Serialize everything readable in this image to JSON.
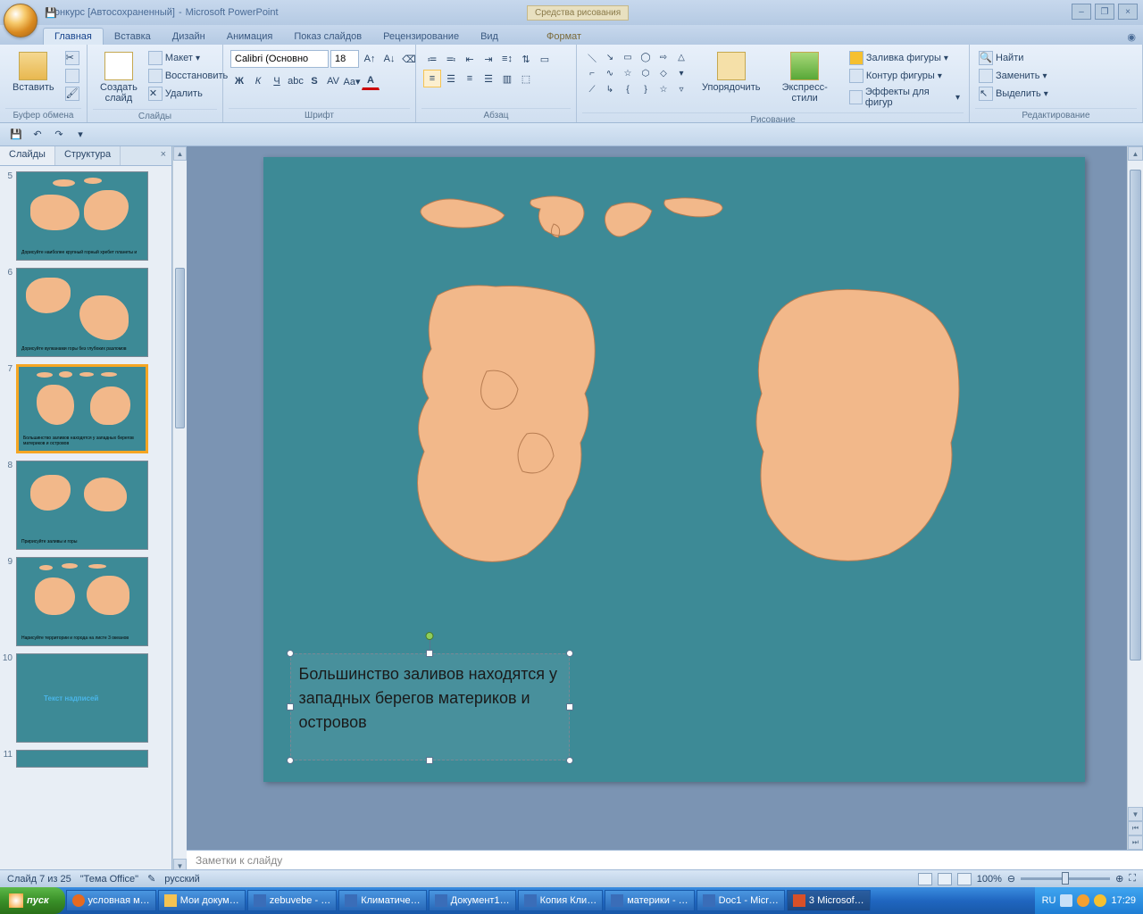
{
  "title": {
    "doc": "конкурс [Автосохраненный]",
    "app": "Microsoft PowerPoint",
    "context_tab": "Средства рисования"
  },
  "win_controls": {
    "min": "–",
    "restore": "❐",
    "close": "×"
  },
  "tabs": {
    "home": "Главная",
    "insert": "Вставка",
    "design": "Дизайн",
    "anim": "Анимация",
    "show": "Показ слайдов",
    "review": "Рецензирование",
    "view": "Вид",
    "format": "Формат"
  },
  "groups": {
    "clipboard": "Буфер обмена",
    "slides": "Слайды",
    "font": "Шрифт",
    "para": "Абзац",
    "drawing": "Рисование",
    "editing": "Редактирование"
  },
  "clipboard": {
    "paste": "Вставить"
  },
  "slides": {
    "new": "Создать\nслайд",
    "layout": "Макет",
    "reset": "Восстановить",
    "delete": "Удалить"
  },
  "font": {
    "name": "Calibri (Основно",
    "size": "18"
  },
  "drawing": {
    "arrange": "Упорядочить",
    "styles": "Экспресс-стили",
    "fill": "Заливка фигуры",
    "outline": "Контур фигуры",
    "effects": "Эффекты для фигур"
  },
  "editing": {
    "find": "Найти",
    "replace": "Заменить",
    "select": "Выделить"
  },
  "panel": {
    "slides_tab": "Слайды",
    "outline_tab": "Структура",
    "close": "×"
  },
  "thumbs": {
    "5": {
      "text": "Дорисуйте наиболее крупный горный хребет планеты и"
    },
    "6": {
      "text": "Дорисуйте вулканами горы без глубоких разломов"
    },
    "7": {
      "text": "Большинство заливов находятся у западных берегов материков и островов"
    },
    "8": {
      "text": "Пририсуйте заливы и горы"
    },
    "9": {
      "text": "Нарисуйте территории и города на листе 3 океанов"
    },
    "10": {
      "text": ""
    },
    "11": {
      "text": ""
    }
  },
  "slide_text": "Большинство заливов находятся у западных берегов материков и островов",
  "notes_placeholder": "Заметки к слайду",
  "status": {
    "slide": "Слайд 7 из 25",
    "theme": "\"Тема Office\"",
    "lang": "русский",
    "zoom": "100%"
  },
  "taskbar": {
    "start": "пуск",
    "items": [
      "условная м…",
      "Мои докум…",
      "zebuvebe - …",
      "Климатиче…",
      "Документ1…",
      "Копия Кли…",
      "материки - …",
      "Doc1 - Micr…",
      "3 Microsof…"
    ],
    "lang": "RU",
    "time": "17:29"
  }
}
